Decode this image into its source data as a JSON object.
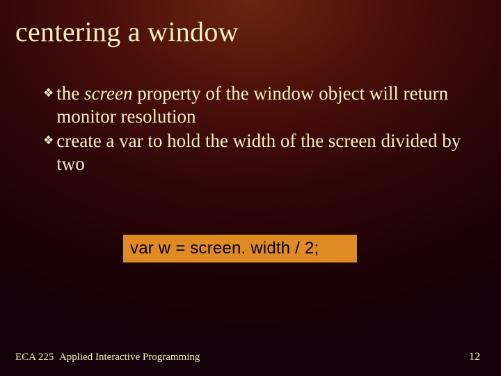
{
  "title": "centering a window",
  "bullets": [
    {
      "prefix": "the ",
      "em": "screen",
      "rest": " property of the window object will return monitor resolution"
    },
    {
      "prefix": "create a var to hold the width of the screen divided by two",
      "em": "",
      "rest": ""
    }
  ],
  "code": "var w = screen. width / 2;",
  "footer": {
    "course": "ECA 225",
    "course_title": "Applied Interactive Programming",
    "page_number": "12"
  },
  "icons": {
    "bullet_glyph": "❖"
  }
}
